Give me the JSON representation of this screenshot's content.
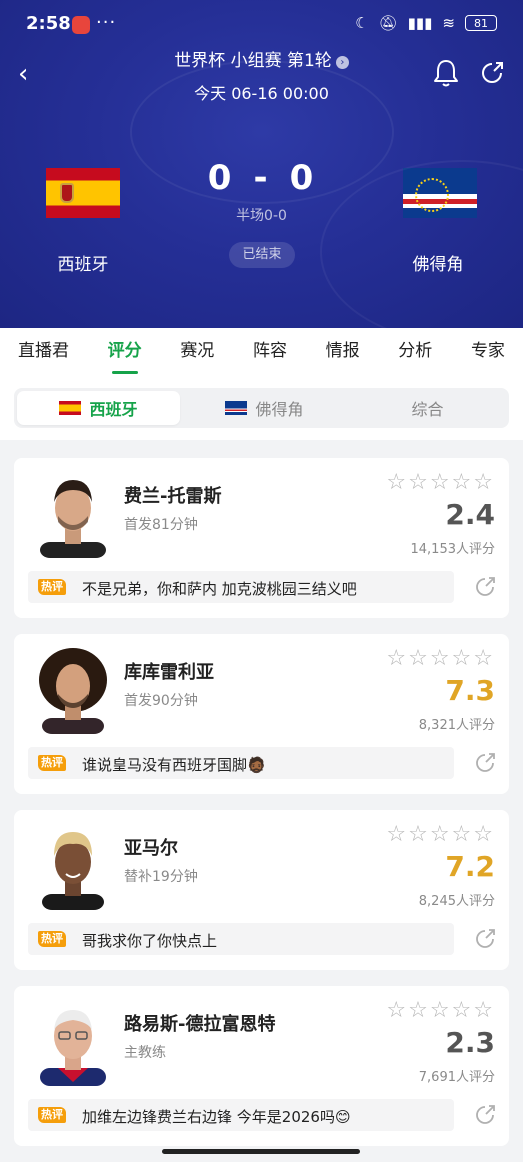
{
  "status_bar": {
    "time": "2:58",
    "dots": "···",
    "battery": "81"
  },
  "header": {
    "title": "世界杯 小组赛 第1轮",
    "date": "今天 06-16 00:00",
    "home_team": "西班牙",
    "away_team": "佛得角",
    "home_score": "0",
    "separator": "-",
    "away_score": "0",
    "halftime": "半场0-0",
    "status": "已结束"
  },
  "tabs": [
    "直播君",
    "评分",
    "赛况",
    "阵容",
    "情报",
    "分析",
    "专家"
  ],
  "active_tab": "评分",
  "segments": [
    {
      "label": "西班牙",
      "active": true
    },
    {
      "label": "佛得角",
      "active": false
    },
    {
      "label": "综合",
      "active": false
    }
  ],
  "players": [
    {
      "name": "费兰-托雷斯",
      "sub": "首发81分钟",
      "rating": "2.4",
      "votes": "14,153人评分",
      "hot_tag": "热评",
      "comment": "不是兄弟，你和萨内 加克波桃园三结义吧"
    },
    {
      "name": "库库雷利亚",
      "sub": "首发90分钟",
      "rating": "7.3",
      "votes": "8,321人评分",
      "hot_tag": "热评",
      "comment": "谁说皇马没有西班牙国脚🧔🏾"
    },
    {
      "name": "亚马尔",
      "sub": "替补19分钟",
      "rating": "7.2",
      "votes": "8,245人评分",
      "hot_tag": "热评",
      "comment": "哥我求你了你快点上"
    },
    {
      "name": "路易斯-德拉富恩特",
      "sub": "主教练",
      "rating": "2.3",
      "votes": "7,691人评分",
      "hot_tag": "热评",
      "comment": "加维左边锋费兰右边锋 今年是2026吗😊"
    }
  ],
  "stars_glyph": "☆☆☆☆☆",
  "colors": {
    "header_bg": "#252f96",
    "accent_green": "#16a34a",
    "rating_high": "#e0a526",
    "rating_low": "#555555",
    "hot_tag": "#f59e0b"
  }
}
